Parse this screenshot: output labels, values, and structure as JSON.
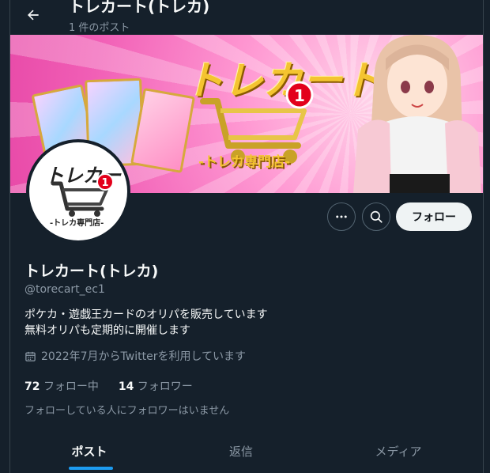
{
  "header": {
    "title": "トレカート(トレカ)",
    "post_count": "1 件のポスト"
  },
  "banner": {
    "logo_text": "トレカート",
    "badge_number": "1",
    "shop_text": "-トレカ専門店-"
  },
  "avatar": {
    "logo_text": "トレカート",
    "badge_number": "1",
    "shop_text": "-トレカ専門店-"
  },
  "actions": {
    "follow_label": "フォロー"
  },
  "profile": {
    "name": "トレカート(トレカ)",
    "handle": "@torecart_ec1",
    "bio_line1": "ポケカ・遊戯王カードのオリパを販売しています",
    "bio_line2": "無料オリパも定期的に開催します",
    "joined": "2022年7月からTwitterを利用しています",
    "following_count": "72",
    "following_label": "フォロー中",
    "followers_count": "14",
    "followers_label": "フォロワー",
    "followed_by": "フォローしている人にフォロワーはいません"
  },
  "tabs": [
    {
      "label": "ポスト",
      "active": true
    },
    {
      "label": "返信",
      "active": false
    },
    {
      "label": "メディア",
      "active": false
    }
  ],
  "colors": {
    "background": "#15202b",
    "accent": "#1d9bf0",
    "muted_text": "#8b98a5"
  },
  "icons": [
    "back-arrow-icon",
    "more-icon",
    "search-icon",
    "calendar-icon"
  ]
}
